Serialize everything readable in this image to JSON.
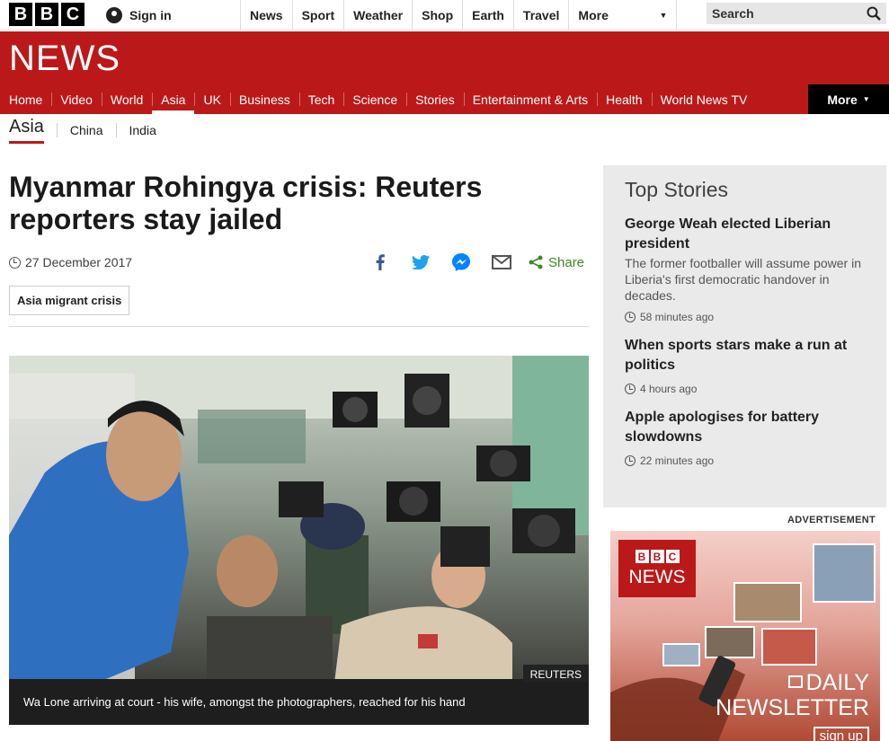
{
  "topbar": {
    "logo_letters": [
      "B",
      "B",
      "C"
    ],
    "signin_label": "Sign in",
    "nav": [
      "News",
      "Sport",
      "Weather",
      "Shop",
      "Earth",
      "Travel"
    ],
    "more_label": "More",
    "search_placeholder": "Search"
  },
  "banner": {
    "title": "NEWS"
  },
  "section_nav": {
    "items": [
      "Home",
      "Video",
      "World",
      "Asia",
      "UK",
      "Business",
      "Tech",
      "Science",
      "Stories",
      "Entertainment & Arts",
      "Health",
      "World News TV"
    ],
    "active": "Asia",
    "more_label": "More"
  },
  "sub_nav": {
    "current": "Asia",
    "items": [
      "China",
      "India"
    ]
  },
  "article": {
    "headline": "Myanmar Rohingya crisis: Reuters reporters stay jailed",
    "date": "27 December 2017",
    "share_label": "Share",
    "tag": "Asia migrant crisis",
    "image_credit": "REUTERS",
    "caption": "Wa Lone arriving at court - his wife, amongst the photographers, reached for his hand"
  },
  "top_stories": {
    "heading": "Top Stories",
    "items": [
      {
        "title": "George Weah elected Liberian president",
        "summary": "The former footballer will assume power in Liberia's first democratic handover in decades.",
        "ago": "58 minutes ago"
      },
      {
        "title": "When sports stars make a run at politics",
        "summary": "",
        "ago": "4 hours ago"
      },
      {
        "title": "Apple apologises for battery slowdowns",
        "summary": "",
        "ago": "22 minutes ago"
      }
    ]
  },
  "ad": {
    "label": "ADVERTISEMENT",
    "logo_letters": [
      "B",
      "B",
      "C"
    ],
    "logo_news": "NEWS",
    "daily": "DAILY",
    "newsletter": "NEWSLETTER",
    "signup": "sign up"
  },
  "colors": {
    "brand_red": "#bb1919",
    "share_green": "#3d8a22"
  }
}
